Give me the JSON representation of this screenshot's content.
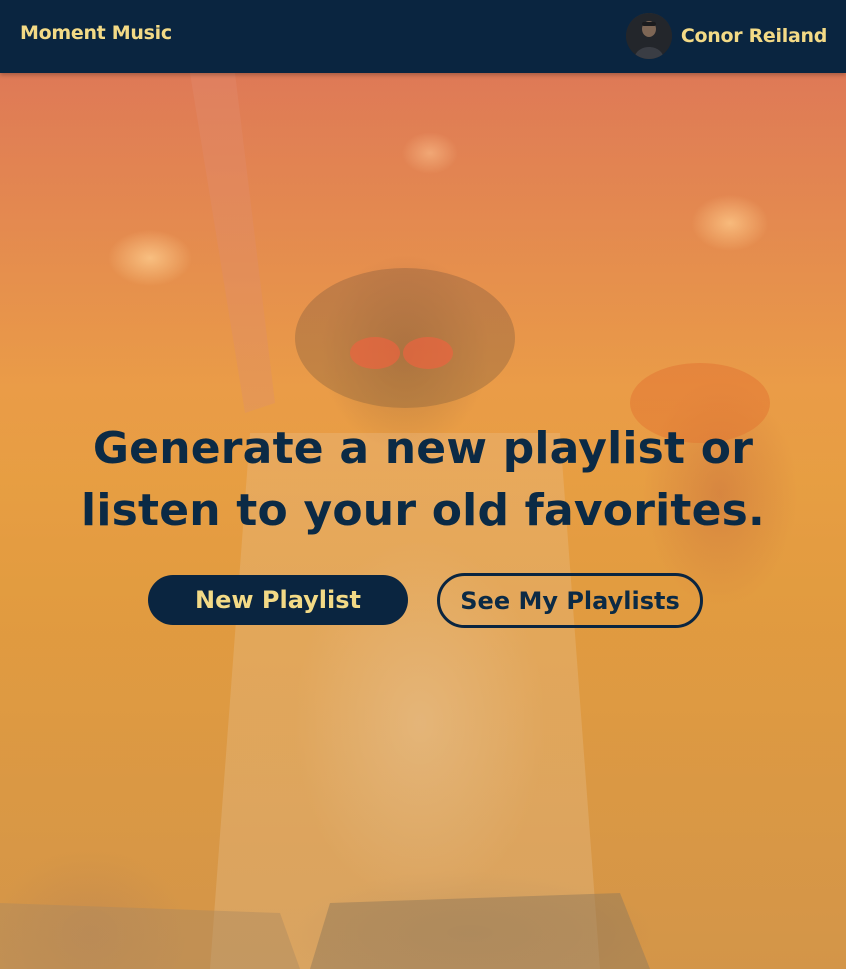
{
  "header": {
    "brand": "Moment Music",
    "user_name": "Conor Reiland"
  },
  "hero": {
    "headline_line1": "Generate a new playlist or",
    "headline_line2": "listen to your old favorites.",
    "primary_button": "New Playlist",
    "secondary_button": "See My Playlists"
  },
  "colors": {
    "navbar_bg": "#0a2540",
    "accent_text": "#f3da86",
    "headline_text": "#0b2a45"
  },
  "icons": {
    "avatar": "user-avatar-photo",
    "hero_background": "concert-crowd-photo"
  }
}
